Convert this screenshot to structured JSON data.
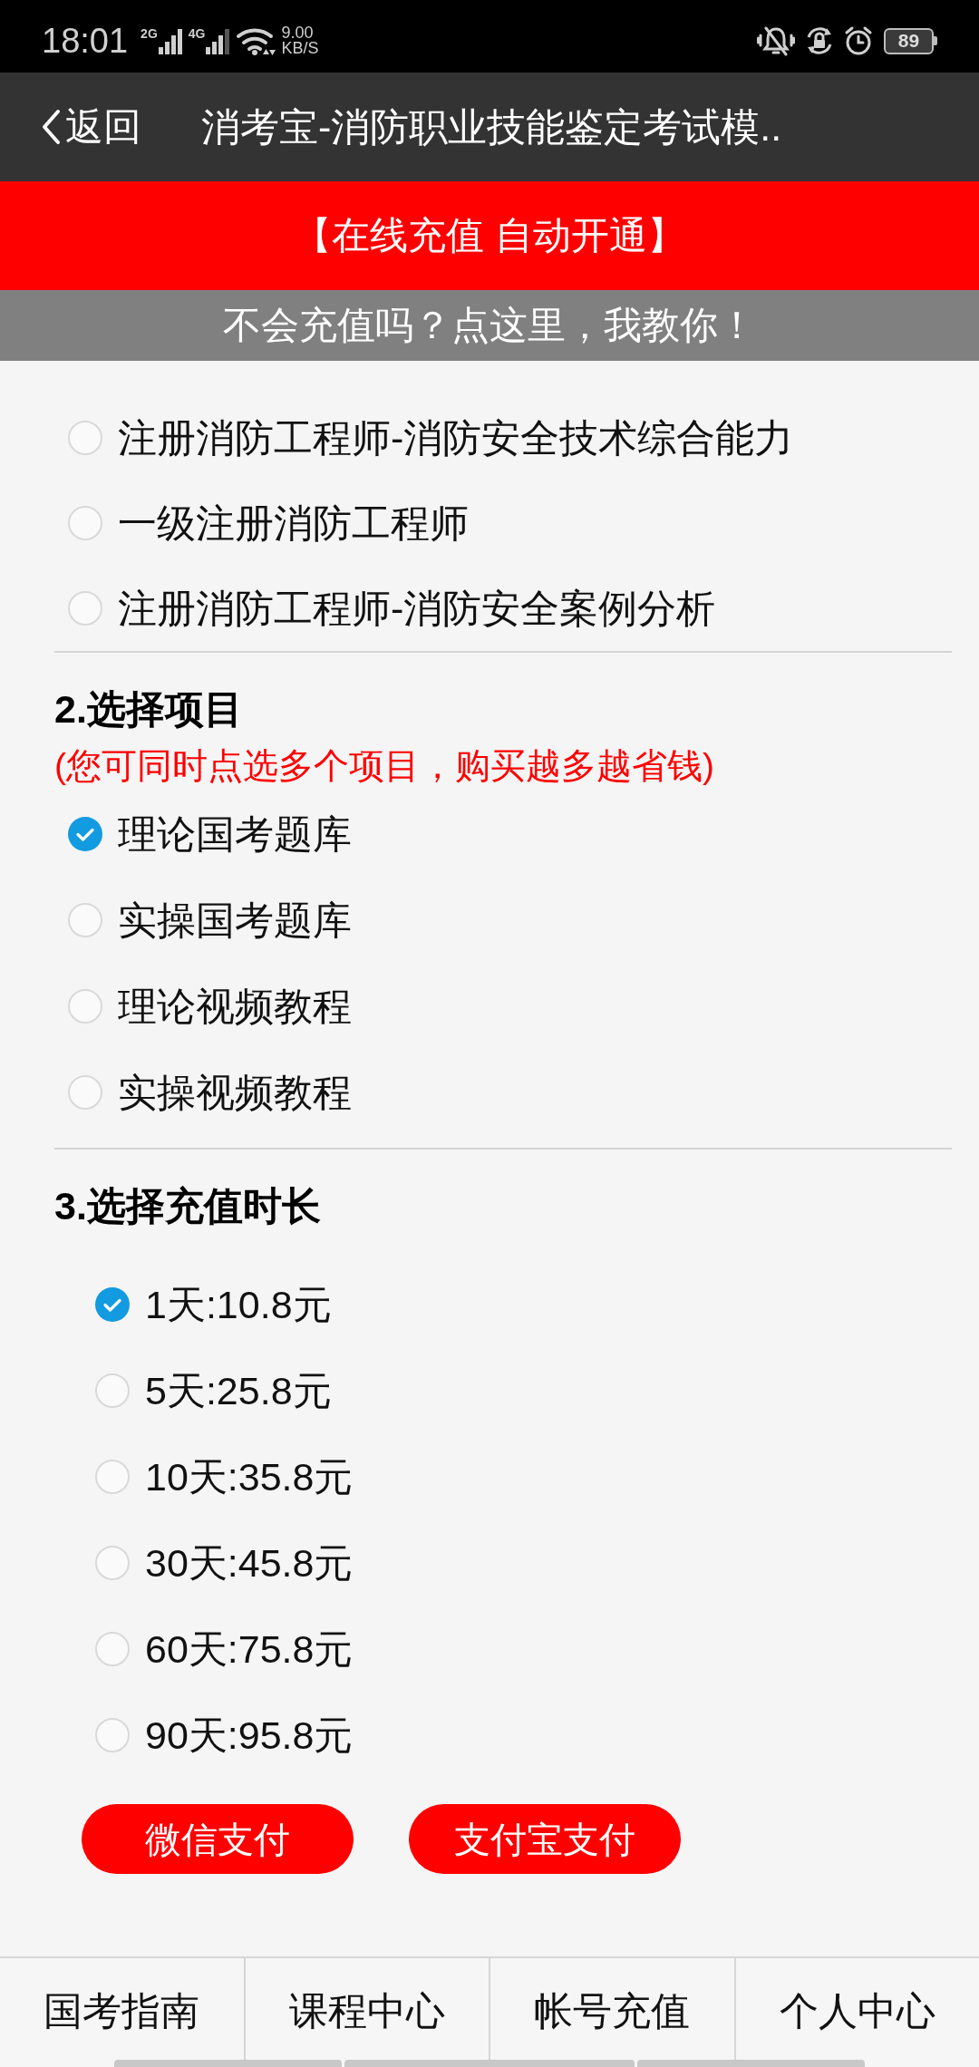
{
  "status_bar": {
    "time": "18:01",
    "signals": [
      {
        "label": "2G"
      },
      {
        "label": "4G"
      }
    ],
    "speed": {
      "value": "9.00",
      "unit": "KB/S"
    },
    "battery": "89"
  },
  "header": {
    "back": "返回",
    "title": "消考宝-消防职业技能鉴定考试模.."
  },
  "banner": "【在线充值 自动开通】",
  "help_link": "不会充值吗？点这里，我教你！",
  "exam_options": [
    {
      "label": "注册消防工程师-消防安全技术综合能力",
      "selected": false
    },
    {
      "label": "一级注册消防工程师",
      "selected": false
    },
    {
      "label": "注册消防工程师-消防安全案例分析",
      "selected": false
    }
  ],
  "projects": {
    "title": "2.选择项目",
    "note": "(您可同时点选多个项目，购买越多越省钱)",
    "options": [
      {
        "label": "理论国考题库",
        "checked": true
      },
      {
        "label": "实操国考题库",
        "checked": false
      },
      {
        "label": "理论视频教程",
        "checked": false
      },
      {
        "label": "实操视频教程",
        "checked": false
      }
    ]
  },
  "durations": {
    "title": "3.选择充值时长",
    "options": [
      {
        "label": "1天:10.8元",
        "selected": true
      },
      {
        "label": "5天:25.8元",
        "selected": false
      },
      {
        "label": "10天:35.8元",
        "selected": false
      },
      {
        "label": "30天:45.8元",
        "selected": false
      },
      {
        "label": "60天:75.8元",
        "selected": false
      },
      {
        "label": "90天:95.8元",
        "selected": false
      }
    ]
  },
  "pay_buttons": [
    "微信支付",
    "支付宝支付"
  ],
  "bottom_nav": [
    {
      "label": "国考指南",
      "selected": false
    },
    {
      "label": "课程中心",
      "selected": false
    },
    {
      "label": "帐号充值",
      "selected": false
    },
    {
      "label": "个人中心",
      "selected": false
    }
  ]
}
